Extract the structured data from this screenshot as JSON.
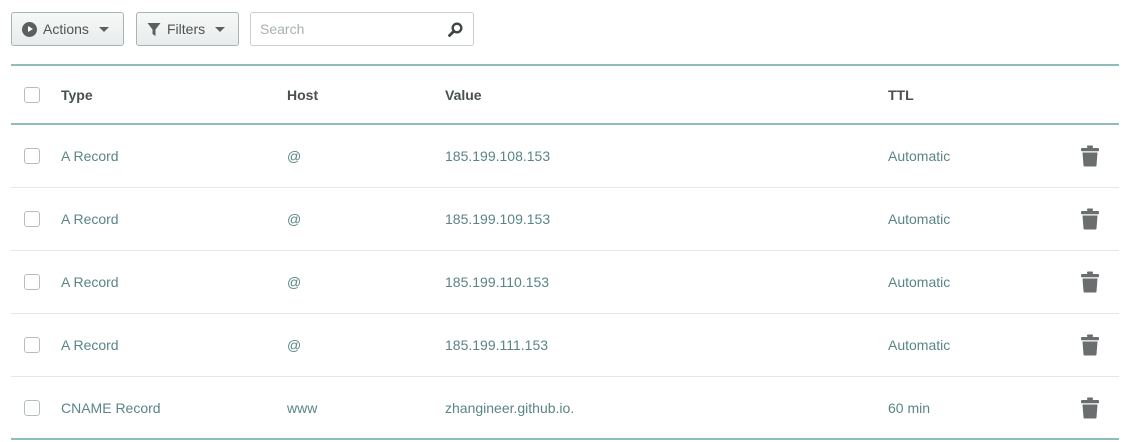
{
  "toolbar": {
    "actions_label": "Actions",
    "filters_label": "Filters",
    "search_placeholder": "Search",
    "search_value": ""
  },
  "table": {
    "headers": {
      "type": "Type",
      "host": "Host",
      "value": "Value",
      "ttl": "TTL"
    },
    "rows": [
      {
        "type": "A Record",
        "host": "@",
        "value": "185.199.108.153",
        "ttl": "Automatic"
      },
      {
        "type": "A Record",
        "host": "@",
        "value": "185.199.109.153",
        "ttl": "Automatic"
      },
      {
        "type": "A Record",
        "host": "@",
        "value": "185.199.110.153",
        "ttl": "Automatic"
      },
      {
        "type": "A Record",
        "host": "@",
        "value": "185.199.111.153",
        "ttl": "Automatic"
      },
      {
        "type": "CNAME Record",
        "host": "www",
        "value": "zhangineer.github.io.",
        "ttl": "60 min"
      }
    ]
  },
  "icons": {
    "actions": "play-circle-icon",
    "filters": "funnel-icon",
    "search": "search-icon",
    "delete": "trash-icon",
    "dropdown": "caret-down-icon"
  },
  "colors": {
    "accent_border": "#8fbcbc",
    "row_text": "#5b8585",
    "header_text": "#4a5050"
  }
}
